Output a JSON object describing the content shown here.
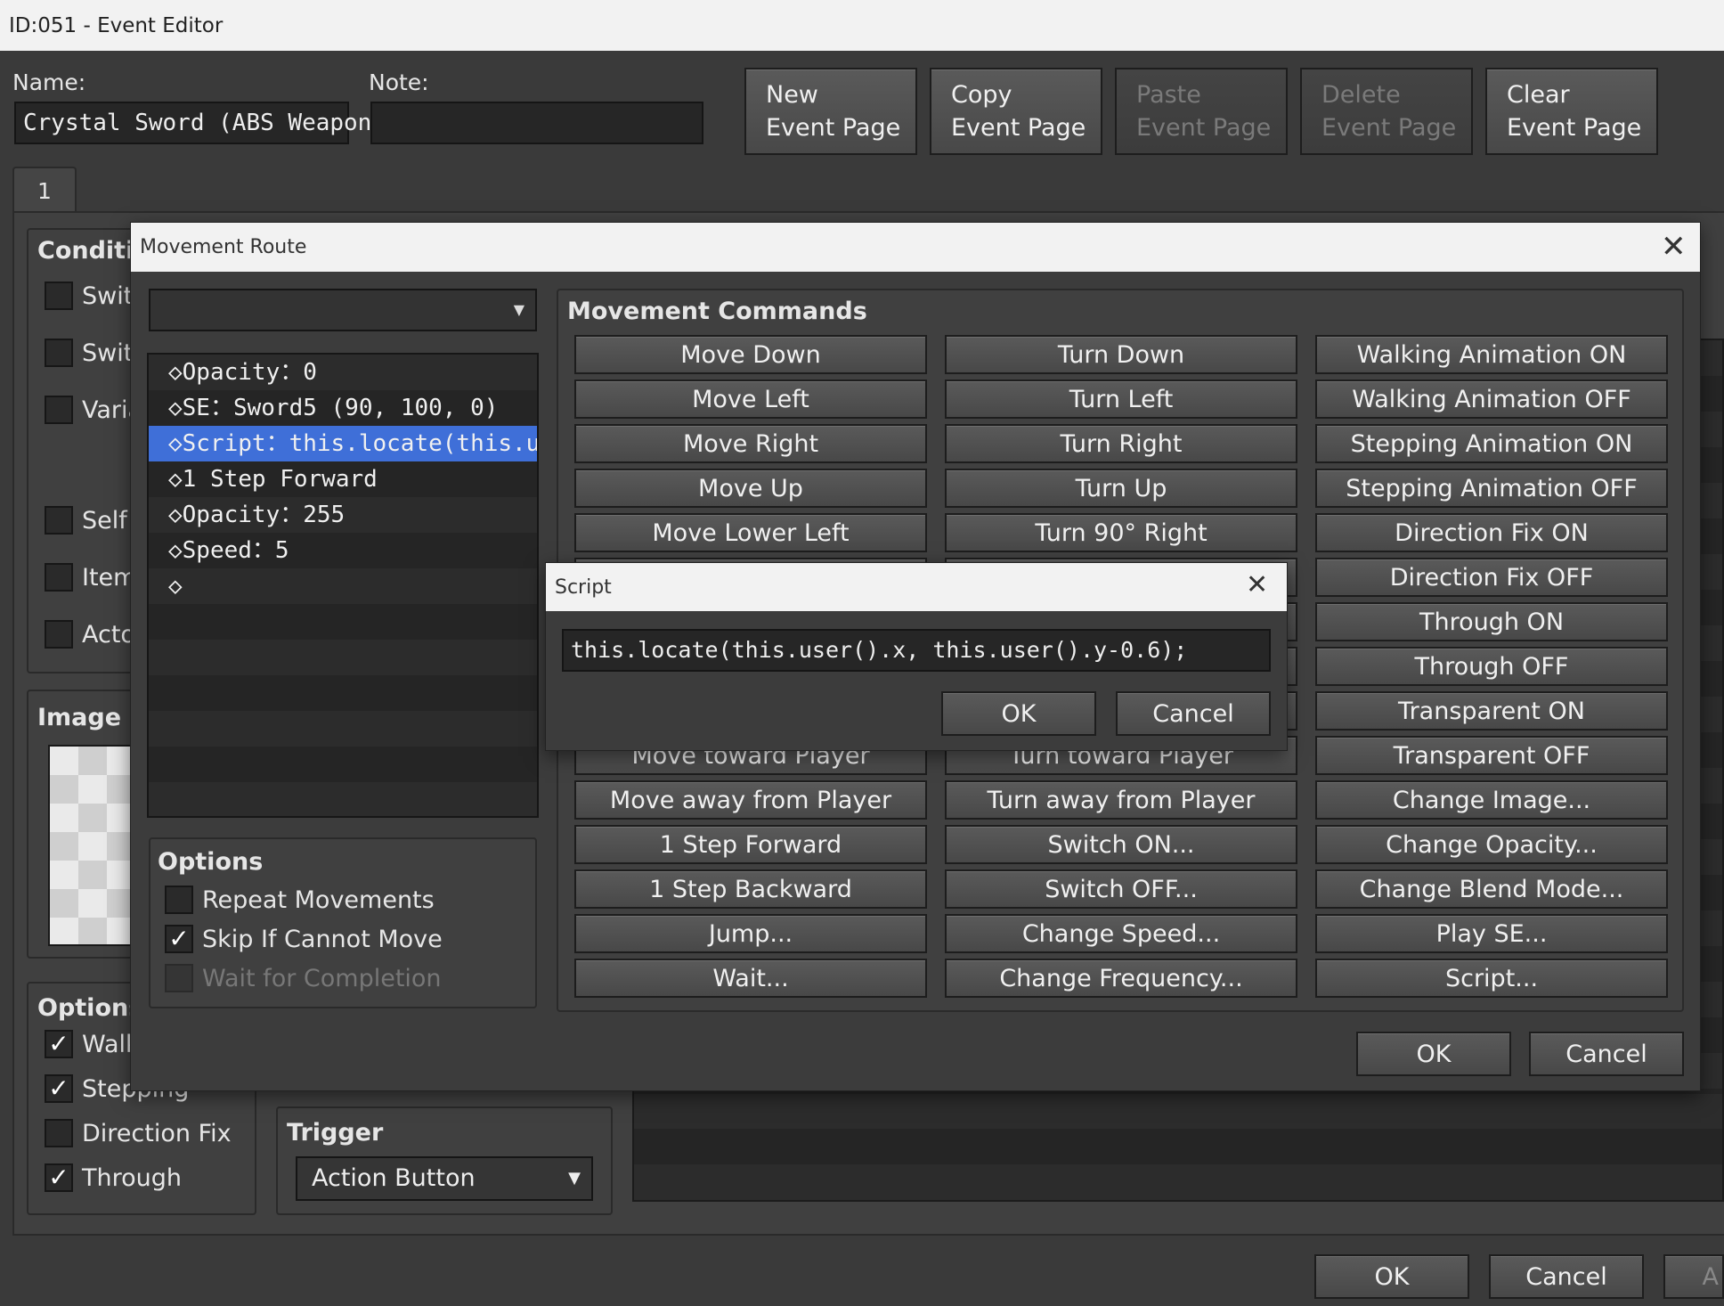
{
  "event_editor": {
    "title": "ID:051 - Event Editor",
    "name_label": "Name:",
    "name_value": "Crystal Sword (ABS Weapon)",
    "note_label": "Note:",
    "note_value": "",
    "page_buttons": [
      {
        "line1": "New",
        "line2": "Event Page",
        "enabled": true
      },
      {
        "line1": "Copy",
        "line2": "Event Page",
        "enabled": true
      },
      {
        "line1": "Paste",
        "line2": "Event Page",
        "enabled": false
      },
      {
        "line1": "Delete",
        "line2": "Event Page",
        "enabled": false
      },
      {
        "line1": "Clear",
        "line2": "Event Page",
        "enabled": true
      }
    ],
    "tab_label": "1",
    "conditions_label": "Conditi",
    "conditions": [
      "Swit",
      "Swit",
      "Varia",
      "Self",
      "Item",
      "Acto"
    ],
    "image_label": "Image",
    "options_label": "Options",
    "options": [
      {
        "label": "Walk",
        "checked": true
      },
      {
        "label": "Stepping",
        "checked": true
      },
      {
        "label": "Direction Fix",
        "checked": false
      },
      {
        "label": "Through",
        "checked": true
      }
    ],
    "trigger_label": "Trigger",
    "trigger_value": "Action Button",
    "ok_label": "OK",
    "cancel_label": "Cancel",
    "apply_label": "A"
  },
  "movement_route": {
    "title": "Movement Route",
    "target_value": "",
    "route_items": [
      "◇Opacity：0",
      "◇SE：Sword5 (90, 100, 0)",
      "◇Script：this.locate(this.u···",
      "◇1 Step Forward",
      "◇Opacity：255",
      "◇Speed：5",
      "◇"
    ],
    "selected_index": 2,
    "options_label": "Options",
    "options": [
      {
        "label": "Repeat Movements",
        "checked": false,
        "enabled": true
      },
      {
        "label": "Skip If Cannot Move",
        "checked": true,
        "enabled": true
      },
      {
        "label": "Wait for Completion",
        "checked": false,
        "enabled": false
      }
    ],
    "commands_label": "Movement Commands",
    "commands": [
      [
        "Move Down",
        "Turn Down",
        "Walking Animation ON"
      ],
      [
        "Move Left",
        "Turn Left",
        "Walking Animation OFF"
      ],
      [
        "Move Right",
        "Turn Right",
        "Stepping Animation ON"
      ],
      [
        "Move Up",
        "Turn Up",
        "Stepping Animation OFF"
      ],
      [
        "Move Lower Left",
        "Turn 90° Right",
        "Direction Fix ON"
      ],
      [
        "",
        "",
        "Direction Fix OFF"
      ],
      [
        "",
        "",
        "Through ON"
      ],
      [
        "",
        "",
        "Through OFF"
      ],
      [
        "",
        "",
        "Transparent ON"
      ],
      [
        "Move toward Player",
        "Turn toward Player",
        "Transparent OFF"
      ],
      [
        "Move away from Player",
        "Turn away from Player",
        "Change Image..."
      ],
      [
        "1 Step Forward",
        "Switch ON...",
        "Change Opacity..."
      ],
      [
        "1 Step Backward",
        "Switch OFF...",
        "Change Blend Mode..."
      ],
      [
        "Jump...",
        "Change Speed...",
        "Play SE..."
      ],
      [
        "Wait...",
        "Change Frequency...",
        "Script..."
      ]
    ],
    "ok_label": "OK",
    "cancel_label": "Cancel"
  },
  "script_dialog": {
    "title": "Script",
    "script_value": "this.locate(this.user().x, this.user().y-0.6);",
    "ok_label": "OK",
    "cancel_label": "Cancel"
  },
  "icons": {
    "close": "close-icon",
    "dropdown": "chevron-down-icon",
    "check": "checkmark-icon"
  }
}
